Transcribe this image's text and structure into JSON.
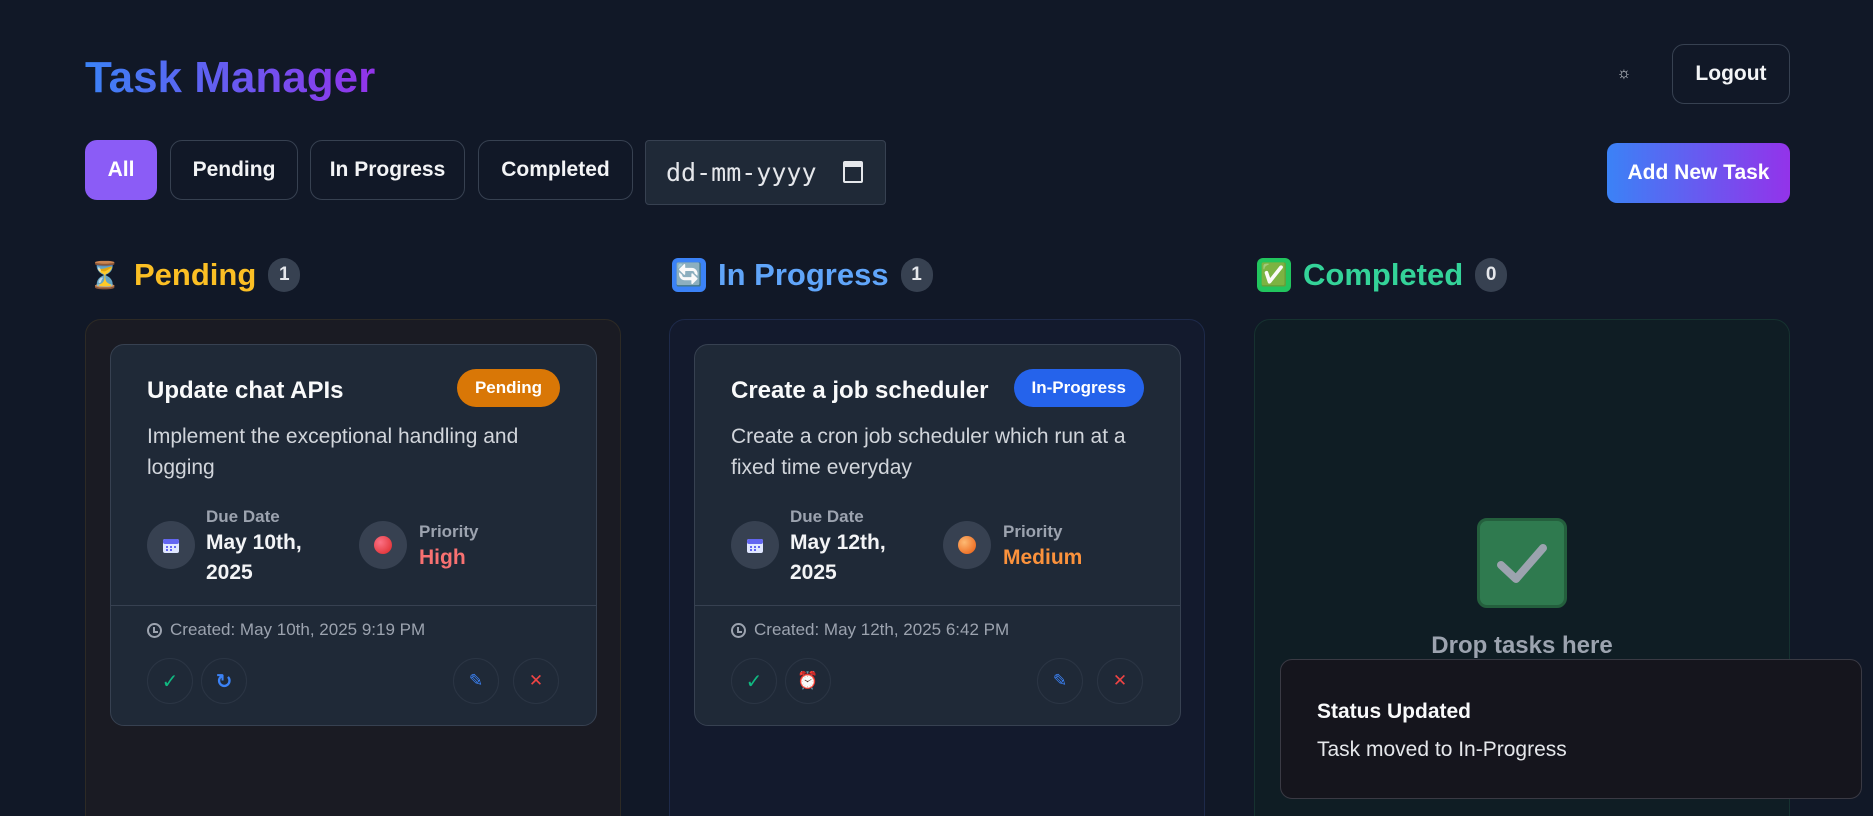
{
  "header": {
    "title": "Task Manager",
    "theme_toggle_icon": "☼",
    "logout_label": "Logout"
  },
  "filters": {
    "all": "All",
    "pending": "Pending",
    "in_progress": "In Progress",
    "completed": "Completed",
    "date_placeholder": "dd-mm-yyyy",
    "active": "All"
  },
  "add_task_label": "Add New Task",
  "columns": {
    "pending": {
      "title": "Pending",
      "count": "1",
      "icon": "⏳",
      "color": "#f59e0b"
    },
    "in_progress": {
      "title": "In Progress",
      "count": "1",
      "icon": "🔄",
      "color": "#60a5fa"
    },
    "completed": {
      "title": "Completed",
      "count": "0",
      "icon": "✅",
      "color": "#34d399"
    }
  },
  "tasks": {
    "pending": {
      "title": "Update chat APIs",
      "status": "Pending",
      "status_color": "#d97706",
      "description": "Implement the exceptional handling and logging",
      "due_label": "Due Date",
      "due_line1": "May 10th,",
      "due_line2": "2025",
      "priority_label": "Priority",
      "priority": "High",
      "priority_color": "#f87171",
      "created": "Created: May 10th, 2025 9:19 PM"
    },
    "in_progress": {
      "title": "Create a job scheduler",
      "status": "In-Progress",
      "status_color": "#2563eb",
      "description": "Create a cron job scheduler which run at a fixed time everyday",
      "due_label": "Due Date",
      "due_line1": "May 12th,",
      "due_line2": "2025",
      "priority_label": "Priority",
      "priority": "Medium",
      "priority_color": "#fb923c",
      "created": "Created: May 12th, 2025 6:42 PM"
    }
  },
  "completed_empty_text": "Drop tasks here",
  "toast": {
    "title": "Status Updated",
    "message": "Task moved to In-Progress"
  }
}
